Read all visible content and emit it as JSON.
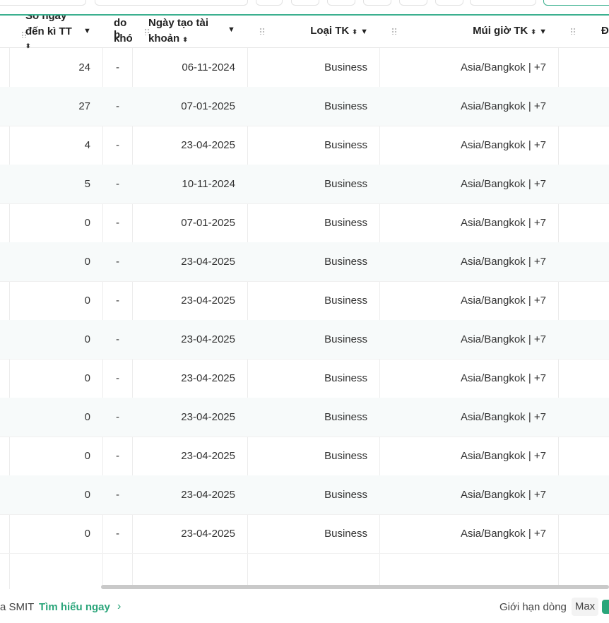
{
  "columns": {
    "days_to_payment": {
      "line1": "Số ngày",
      "line2": "đến kì TT"
    },
    "lock_reason": {
      "line1": "do b",
      "line2": "khó"
    },
    "created_date": {
      "line1": "Ngày tạo tài",
      "line2": "khoản"
    },
    "account_type": {
      "label": "Loại TK"
    },
    "timezone": {
      "label": "Múi giờ TK"
    },
    "next": {
      "label": "Đ"
    }
  },
  "rows": [
    {
      "days": "24",
      "lock": "-",
      "created": "06-11-2024",
      "type": "Business",
      "tz": "Asia/Bangkok | +7"
    },
    {
      "days": "27",
      "lock": "-",
      "created": "07-01-2025",
      "type": "Business",
      "tz": "Asia/Bangkok | +7"
    },
    {
      "days": "4",
      "lock": "-",
      "created": "23-04-2025",
      "type": "Business",
      "tz": "Asia/Bangkok | +7"
    },
    {
      "days": "5",
      "lock": "-",
      "created": "10-11-2024",
      "type": "Business",
      "tz": "Asia/Bangkok | +7"
    },
    {
      "days": "0",
      "lock": "-",
      "created": "07-01-2025",
      "type": "Business",
      "tz": "Asia/Bangkok | +7"
    },
    {
      "days": "0",
      "lock": "-",
      "created": "23-04-2025",
      "type": "Business",
      "tz": "Asia/Bangkok | +7"
    },
    {
      "days": "0",
      "lock": "-",
      "created": "23-04-2025",
      "type": "Business",
      "tz": "Asia/Bangkok | +7"
    },
    {
      "days": "0",
      "lock": "-",
      "created": "23-04-2025",
      "type": "Business",
      "tz": "Asia/Bangkok | +7"
    },
    {
      "days": "0",
      "lock": "-",
      "created": "23-04-2025",
      "type": "Business",
      "tz": "Asia/Bangkok | +7"
    },
    {
      "days": "0",
      "lock": "-",
      "created": "23-04-2025",
      "type": "Business",
      "tz": "Asia/Bangkok | +7"
    },
    {
      "days": "0",
      "lock": "-",
      "created": "23-04-2025",
      "type": "Business",
      "tz": "Asia/Bangkok | +7"
    },
    {
      "days": "0",
      "lock": "-",
      "created": "23-04-2025",
      "type": "Business",
      "tz": "Asia/Bangkok | +7"
    },
    {
      "days": "0",
      "lock": "-",
      "created": "23-04-2025",
      "type": "Business",
      "tz": "Asia/Bangkok | +7"
    }
  ],
  "footer": {
    "brand": "a SMIT",
    "learn_more": "Tìm hiểu ngay",
    "chevron": "›",
    "row_limit_label": "Giới hạn dòng",
    "row_limit_value": "Max"
  },
  "icons": {
    "sort": "⬍",
    "caret": "▼"
  },
  "colors": {
    "accent": "#3bb08f",
    "link": "#2aa57a"
  }
}
